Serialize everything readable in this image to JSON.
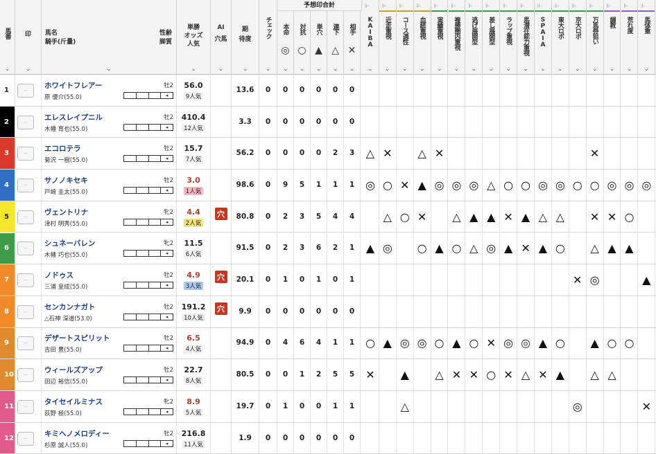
{
  "header": {
    "umaban": "馬番",
    "mark": "印",
    "horse_name": "馬名",
    "jockey": "騎手(斤量)",
    "sex_age": "性齢",
    "kyakushitsu": "脚質",
    "odds": "単勝",
    "odds2": "オッズ",
    "popularity": "人気",
    "ai": "AI",
    "ai2": "穴馬",
    "expect": "期",
    "expect2": "待度",
    "check": "チェック",
    "group_title": "予想印合計",
    "sum_cols": [
      {
        "label": "本命",
        "symbol": "◎"
      },
      {
        "label": "対抗",
        "symbol": "○"
      },
      {
        "label": "単穴",
        "symbol": "▲"
      },
      {
        "label": "連下",
        "symbol": "△"
      },
      {
        "label": "相手",
        "symbol": "✕"
      }
    ],
    "predictors": [
      "KAIBA",
      "近走重視",
      "コース適性",
      "血統重視",
      "実績重視",
      "複勝圏内重視",
      "逃げ展開型",
      "差し展開型",
      "ラップ重視",
      "馬潜在能力重視",
      "SPAIA",
      "東大ロボ",
      "京大ロボ",
      "万馬券狙い",
      "調教",
      "荒れ度",
      "馬体重"
    ]
  },
  "rows": [
    {
      "num": "1",
      "color": "#ffffff",
      "text": "#222",
      "name": "ホワイトフレアー",
      "jockey": "原 優介(55.0)",
      "sex": "牡2",
      "odds": "56.0",
      "pop": "9人気",
      "oddsColor": "#222",
      "popBg": "#f0f0f0",
      "ai": "",
      "expect": "13.6",
      "check": "0",
      "sums": [
        "0",
        "0",
        "0",
        "0",
        "0"
      ],
      "marks": [
        "",
        "",
        "",
        "",
        "",
        "",
        "",
        "",
        "",
        "",
        "",
        "",
        "",
        "",
        "",
        "",
        ""
      ]
    },
    {
      "num": "2",
      "color": "#000000",
      "text": "#fff",
      "name": "エレスレイプニル",
      "jockey": "木幡 育也(55.0)",
      "sex": "牡2",
      "odds": "410.4",
      "pop": "12人気",
      "oddsColor": "#222",
      "popBg": "#f0f0f0",
      "ai": "",
      "expect": "3.3",
      "check": "0",
      "sums": [
        "0",
        "0",
        "0",
        "0",
        "0"
      ],
      "marks": [
        "",
        "",
        "",
        "",
        "",
        "",
        "",
        "",
        "",
        "",
        "",
        "",
        "",
        "",
        "",
        "",
        ""
      ]
    },
    {
      "num": "3",
      "color": "#d93a2b",
      "text": "#fff",
      "name": "エコロテラ",
      "jockey": "菊沢 一樹(55.0)",
      "sex": "牡2",
      "odds": "15.7",
      "pop": "7人気",
      "oddsColor": "#222",
      "popBg": "#f0f0f0",
      "ai": "",
      "expect": "56.2",
      "check": "0",
      "sums": [
        "0",
        "0",
        "0",
        "2",
        "3"
      ],
      "marks": [
        "△",
        "✕",
        "",
        "△",
        "✕",
        "",
        "",
        "",
        "",
        "",
        "",
        "",
        "",
        "✕",
        "",
        "",
        ""
      ]
    },
    {
      "num": "4",
      "color": "#2e6fc4",
      "text": "#fff",
      "name": "サノノキセキ",
      "jockey": "戸崎 圭太(55.0)",
      "sex": "牡2",
      "odds": "3.0",
      "pop": "1人気",
      "oddsColor": "#b83a2a",
      "popBg": "#f5b3c3",
      "ai": "",
      "expect": "98.6",
      "check": "0",
      "sums": [
        "9",
        "5",
        "1",
        "1",
        "1"
      ],
      "marks": [
        "◎",
        "○",
        "✕",
        "▲",
        "◎",
        "◎",
        "◎",
        "△",
        "○",
        "○",
        "◎",
        "◎",
        "○",
        "○",
        "◎",
        "◎",
        "◎"
      ]
    },
    {
      "num": "5",
      "color": "#f5e629",
      "text": "#222",
      "name": "ヴェントリナ",
      "jockey": "津村 明秀(55.0)",
      "sex": "牝2",
      "odds": "4.4",
      "pop": "2人気",
      "oddsColor": "#b83a2a",
      "popBg": "#f6e27c",
      "ai": "穴",
      "expect": "80.8",
      "check": "0",
      "sums": [
        "2",
        "3",
        "5",
        "4",
        "4"
      ],
      "marks": [
        "",
        "△",
        "○",
        "✕",
        "",
        "△",
        "▲",
        "▲",
        "✕",
        "▲",
        "△",
        "△",
        "",
        "✕",
        "✕",
        "○",
        ""
      ]
    },
    {
      "num": "6",
      "color": "#3f9c47",
      "text": "#fff",
      "name": "シュネーバレン",
      "jockey": "木幡 巧也(55.0)",
      "sex": "牝2",
      "odds": "11.5",
      "pop": "6人気",
      "oddsColor": "#222",
      "popBg": "#f0f0f0",
      "ai": "",
      "expect": "91.5",
      "check": "0",
      "sums": [
        "2",
        "3",
        "6",
        "2",
        "1"
      ],
      "marks": [
        "▲",
        "◎",
        "",
        "○",
        "▲",
        "○",
        "△",
        "◎",
        "▲",
        "✕",
        "▲",
        "○",
        "",
        "△",
        "▲",
        "▲",
        ""
      ]
    },
    {
      "num": "7",
      "color": "#f08a2a",
      "text": "#fff",
      "name": "ノドゥス",
      "jockey": "三浦 皇成(55.0)",
      "sex": "牡2",
      "odds": "4.9",
      "pop": "3人気",
      "oddsColor": "#b83a2a",
      "popBg": "#a9c7e8",
      "ai": "穴",
      "expect": "20.1",
      "check": "0",
      "sums": [
        "1",
        "0",
        "1",
        "0",
        "1"
      ],
      "marks": [
        "",
        "",
        "",
        "",
        "",
        "",
        "",
        "",
        "",
        "",
        "",
        "",
        "✕",
        "◎",
        "",
        "",
        "▲"
      ]
    },
    {
      "num": "8",
      "color": "#f08a2a",
      "text": "#fff",
      "name": "センカンナガト",
      "jockey": "△石神 深道(53.0)",
      "sex": "牡2",
      "odds": "191.2",
      "pop": "10人気",
      "oddsColor": "#222",
      "popBg": "#f0f0f0",
      "ai": "穴",
      "expect": "9.9",
      "check": "0",
      "sums": [
        "0",
        "0",
        "0",
        "0",
        "0"
      ],
      "marks": [
        "",
        "",
        "",
        "",
        "",
        "",
        "",
        "",
        "",
        "",
        "",
        "",
        "",
        "",
        "",
        "",
        ""
      ]
    },
    {
      "num": "9",
      "color": "#e08a2e",
      "text": "#fff",
      "name": "デザートスピリット",
      "jockey": "吉田 豊(55.0)",
      "sex": "牡2",
      "odds": "6.5",
      "pop": "4人気",
      "oddsColor": "#b83a2a",
      "popBg": "#f0f0f0",
      "ai": "",
      "expect": "94.9",
      "check": "0",
      "sums": [
        "4",
        "6",
        "4",
        "1",
        "1"
      ],
      "marks": [
        "○",
        "▲",
        "◎",
        "◎",
        "○",
        "▲",
        "○",
        "✕",
        "◎",
        "◎",
        "▲",
        "○",
        "",
        "▲",
        "○",
        "○",
        ""
      ]
    },
    {
      "num": "10",
      "color": "#e08a2e",
      "text": "#fff",
      "name": "ウィールズアップ",
      "jockey": "田辺 裕信(55.0)",
      "sex": "牡2",
      "odds": "22.7",
      "pop": "8人気",
      "oddsColor": "#222",
      "popBg": "#f0f0f0",
      "ai": "",
      "expect": "80.5",
      "check": "0",
      "sums": [
        "0",
        "1",
        "2",
        "5",
        "5"
      ],
      "marks": [
        "✕",
        "",
        "▲",
        "",
        "△",
        "✕",
        "✕",
        "○",
        "✕",
        "△",
        "✕",
        "▲",
        "",
        "△",
        "△",
        "",
        ""
      ]
    },
    {
      "num": "11",
      "color": "#e05a8a",
      "text": "#fff",
      "name": "タイセイルミナス",
      "jockey": "荻野 極(55.0)",
      "sex": "牝2",
      "odds": "8.9",
      "pop": "5人気",
      "oddsColor": "#b83a2a",
      "popBg": "#f0f0f0",
      "ai": "",
      "expect": "19.7",
      "check": "0",
      "sums": [
        "1",
        "0",
        "0",
        "1",
        "1"
      ],
      "marks": [
        "",
        "",
        "△",
        "",
        "",
        "",
        "",
        "",
        "",
        "",
        "",
        "",
        "◎",
        "",
        "",
        "",
        "✕"
      ]
    },
    {
      "num": "12",
      "color": "#e05a8a",
      "text": "#fff",
      "name": "キミヘノメロディー",
      "jockey": "杉原 誠人(55.0)",
      "sex": "牡2",
      "odds": "216.8",
      "pop": "11人気",
      "oddsColor": "#222",
      "popBg": "#f0f0f0",
      "ai": "",
      "expect": "1.9",
      "check": "0",
      "sums": [
        "0",
        "0",
        "0",
        "0",
        "0"
      ],
      "marks": [
        "",
        "",
        "",
        "",
        "",
        "",
        "",
        "",
        "",
        "",
        "",
        "",
        "",
        "",
        "",
        "",
        ""
      ]
    }
  ]
}
